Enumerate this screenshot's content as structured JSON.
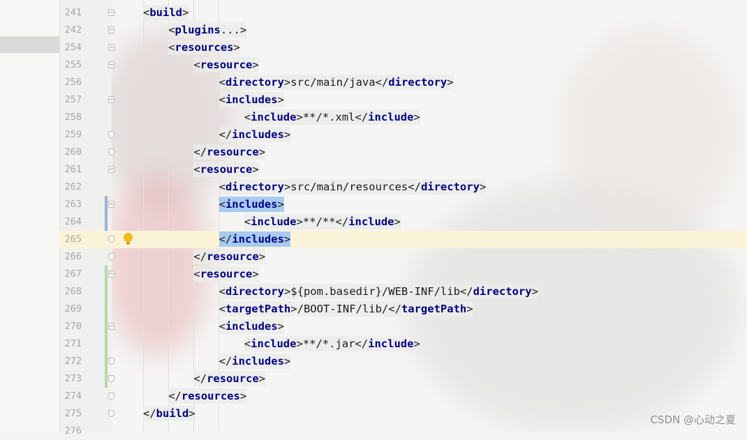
{
  "watermark": "CSDN @心动之夏",
  "lines": [
    {
      "num": "241",
      "tokens": [
        [
          "p",
          "<"
        ],
        [
          "t",
          "build"
        ],
        [
          "p",
          ">"
        ]
      ]
    },
    {
      "num": "242",
      "tokens": [
        [
          "p",
          "<"
        ],
        [
          "t",
          "plugins"
        ],
        [
          "x",
          "..."
        ],
        [
          "p",
          ">"
        ]
      ]
    },
    {
      "num": "254",
      "tokens": [
        [
          "p",
          "<"
        ],
        [
          "t",
          "resources"
        ],
        [
          "p",
          ">"
        ]
      ]
    },
    {
      "num": "255",
      "tokens": [
        [
          "p",
          "<"
        ],
        [
          "t",
          "resource"
        ],
        [
          "p",
          ">"
        ]
      ]
    },
    {
      "num": "256",
      "tokens": [
        [
          "p",
          "<"
        ],
        [
          "t",
          "directory"
        ],
        [
          "p",
          ">"
        ],
        [
          "x",
          "src/main/java"
        ],
        [
          "p",
          "</"
        ],
        [
          "t",
          "directory"
        ],
        [
          "p",
          ">"
        ]
      ]
    },
    {
      "num": "257",
      "tokens": [
        [
          "p",
          "<"
        ],
        [
          "t",
          "includes"
        ],
        [
          "p",
          ">"
        ]
      ]
    },
    {
      "num": "258",
      "tokens": [
        [
          "p",
          "<"
        ],
        [
          "t",
          "include"
        ],
        [
          "p",
          ">"
        ],
        [
          "x",
          "**/*.xml"
        ],
        [
          "p",
          "</"
        ],
        [
          "t",
          "include"
        ],
        [
          "p",
          ">"
        ]
      ]
    },
    {
      "num": "259",
      "tokens": [
        [
          "p",
          "</"
        ],
        [
          "t",
          "includes"
        ],
        [
          "p",
          ">"
        ]
      ]
    },
    {
      "num": "260",
      "tokens": [
        [
          "p",
          "</"
        ],
        [
          "t",
          "resource"
        ],
        [
          "p",
          ">"
        ]
      ]
    },
    {
      "num": "261",
      "tokens": [
        [
          "p",
          "<"
        ],
        [
          "t",
          "resource"
        ],
        [
          "p",
          ">"
        ]
      ]
    },
    {
      "num": "262",
      "tokens": [
        [
          "p",
          "<"
        ],
        [
          "t",
          "directory"
        ],
        [
          "p",
          ">"
        ],
        [
          "x",
          "src/main/resources"
        ],
        [
          "p",
          "</"
        ],
        [
          "t",
          "directory"
        ],
        [
          "p",
          ">"
        ]
      ]
    },
    {
      "num": "263",
      "tokens": [
        [
          "p",
          "<"
        ],
        [
          "t",
          "includes"
        ],
        [
          "p",
          ">"
        ]
      ]
    },
    {
      "num": "264",
      "tokens": [
        [
          "p",
          "<"
        ],
        [
          "t",
          "include"
        ],
        [
          "p",
          ">"
        ],
        [
          "x",
          "**/**"
        ],
        [
          "p",
          "</"
        ],
        [
          "t",
          "include"
        ],
        [
          "p",
          ">"
        ]
      ]
    },
    {
      "num": "265",
      "tokens": [
        [
          "p",
          "</"
        ],
        [
          "t",
          "includes"
        ],
        [
          "p",
          ">"
        ]
      ]
    },
    {
      "num": "266",
      "tokens": [
        [
          "p",
          "</"
        ],
        [
          "t",
          "resource"
        ],
        [
          "p",
          ">"
        ]
      ]
    },
    {
      "num": "267",
      "tokens": [
        [
          "p",
          "<"
        ],
        [
          "t",
          "resource"
        ],
        [
          "p",
          ">"
        ]
      ]
    },
    {
      "num": "268",
      "tokens": [
        [
          "p",
          "<"
        ],
        [
          "t",
          "directory"
        ],
        [
          "p",
          ">"
        ],
        [
          "x",
          "${pom.basedir}/WEB-INF/lib"
        ],
        [
          "p",
          "</"
        ],
        [
          "t",
          "directory"
        ],
        [
          "p",
          ">"
        ]
      ]
    },
    {
      "num": "269",
      "tokens": [
        [
          "p",
          "<"
        ],
        [
          "t",
          "targetPath"
        ],
        [
          "p",
          ">"
        ],
        [
          "x",
          "/BOOT-INF/lib/"
        ],
        [
          "p",
          "</"
        ],
        [
          "t",
          "targetPath"
        ],
        [
          "p",
          ">"
        ]
      ]
    },
    {
      "num": "270",
      "tokens": [
        [
          "p",
          "<"
        ],
        [
          "t",
          "includes"
        ],
        [
          "p",
          ">"
        ]
      ]
    },
    {
      "num": "271",
      "tokens": [
        [
          "p",
          "<"
        ],
        [
          "t",
          "include"
        ],
        [
          "p",
          ">"
        ],
        [
          "x",
          "**/*.jar"
        ],
        [
          "p",
          "</"
        ],
        [
          "t",
          "include"
        ],
        [
          "p",
          ">"
        ]
      ]
    },
    {
      "num": "272",
      "tokens": [
        [
          "p",
          "</"
        ],
        [
          "t",
          "includes"
        ],
        [
          "p",
          ">"
        ]
      ]
    },
    {
      "num": "273",
      "tokens": [
        [
          "p",
          "</"
        ],
        [
          "t",
          "resource"
        ],
        [
          "p",
          ">"
        ]
      ]
    },
    {
      "num": "274",
      "tokens": [
        [
          "p",
          "</"
        ],
        [
          "t",
          "resources"
        ],
        [
          "p",
          ">"
        ]
      ]
    },
    {
      "num": "275",
      "tokens": [
        [
          "p",
          "</"
        ],
        [
          "t",
          "build"
        ],
        [
          "p",
          ">"
        ]
      ]
    },
    {
      "num": "276",
      "tokens": []
    }
  ],
  "icons": {
    "intention": "lightbulb-icon",
    "fold": "fold-marker-icon"
  },
  "colors": {
    "tag": "#000080",
    "selection": "#a8cbf0",
    "caret_line": "#fbf3d8",
    "changed": "#b6d7a8",
    "modified": "#9cb3d6"
  }
}
